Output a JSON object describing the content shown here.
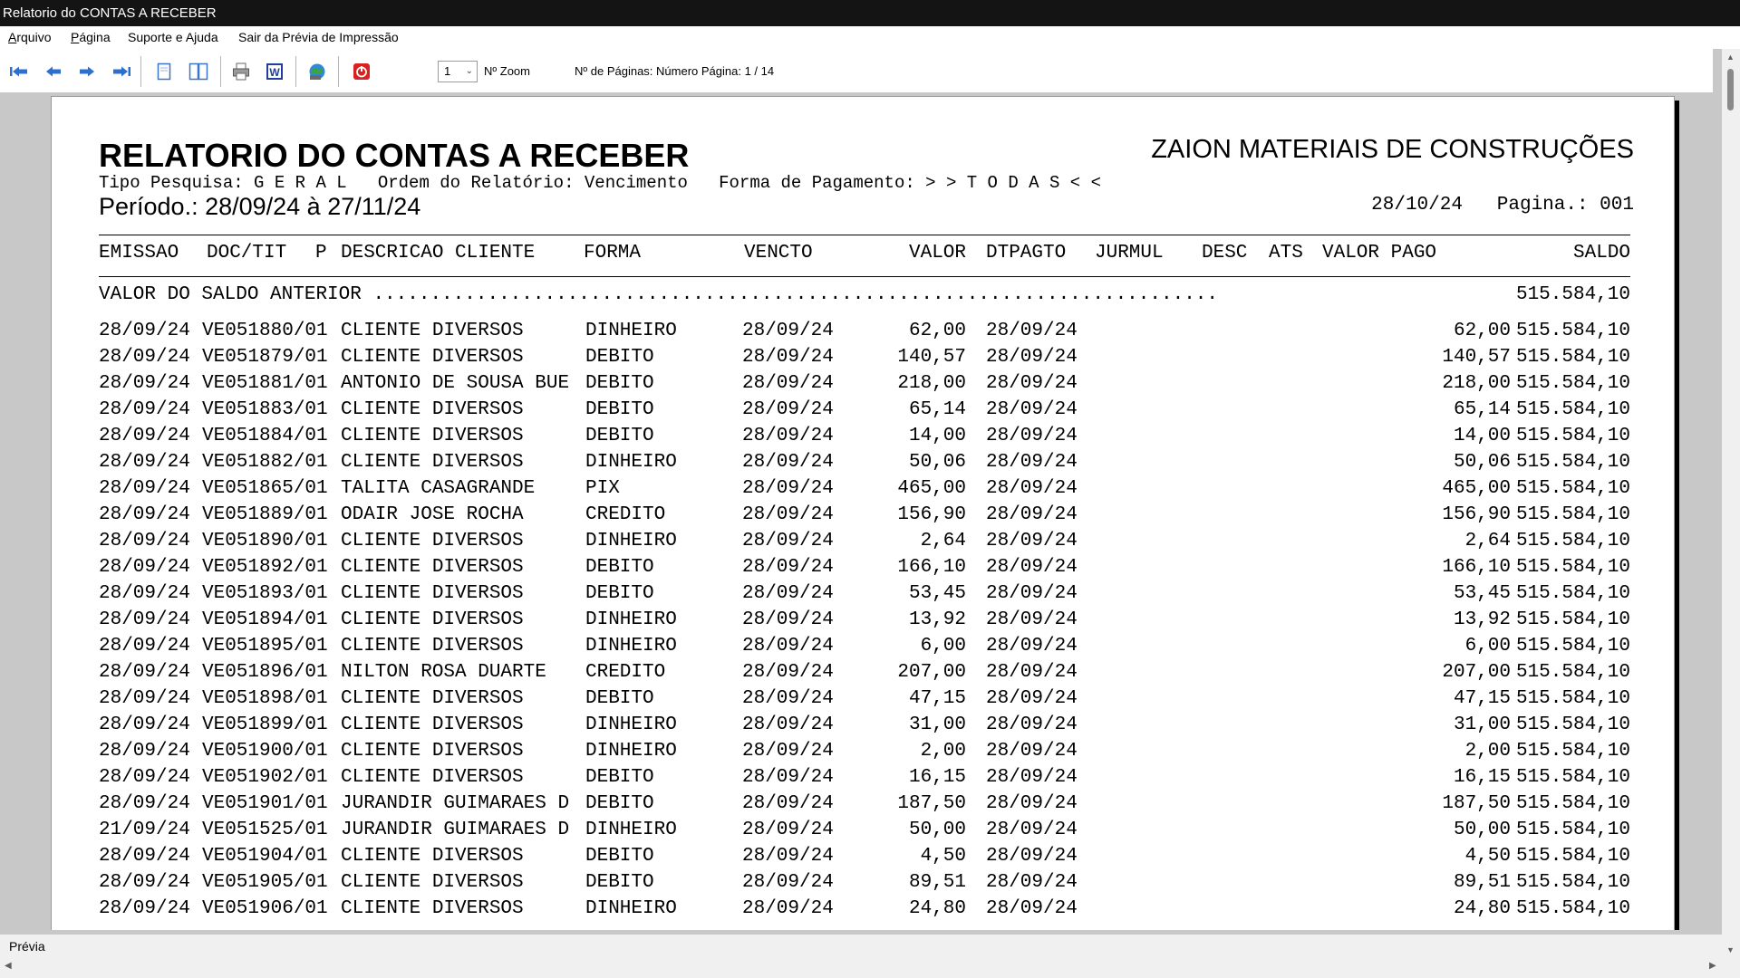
{
  "window": {
    "title": "Relatorio do CONTAS A RECEBER"
  },
  "menu": [
    "Arquivo",
    "Página",
    "Suporte e Ajuda",
    "Sair da Prévia de Impressão"
  ],
  "toolbar": {
    "icons": [
      "first-page-icon",
      "prev-page-icon",
      "next-page-icon",
      "last-page-icon",
      "single-page-icon",
      "two-page-icon",
      "print-icon",
      "word-export-icon",
      "web-export-icon",
      "close-preview-icon"
    ],
    "zoom_value": "1",
    "zoom_label": "Nº Zoom",
    "page_info": "Nº de Páginas: Número Página: 1 / 14"
  },
  "report": {
    "title": "RELATORIO DO CONTAS A RECEBER",
    "company": "ZAION MATERIAIS DE CONSTRUÇÕES",
    "filters": "Tipo Pesquisa: G E R A L   Ordem do Relatório: Vencimento   Forma de Pagamento: > > T O D A S < <",
    "period": "Período.: 28/09/24 à 27/11/24",
    "date_page": "28/10/24   Pagina.: 001",
    "columns": {
      "emissao": "EMISSAO",
      "doc": "DOC/TIT",
      "p": "P",
      "descricao": "DESCRICAO CLIENTE",
      "forma": "FORMA",
      "vencto": "VENCTO",
      "valor": "VALOR",
      "dtpagto": "DTPAGTO",
      "jurmul": "JURMUL",
      "desc": "DESC",
      "ats": "ATS",
      "valor_pago": "VALOR PAGO",
      "saldo": "SALDO"
    },
    "previous_balance": {
      "label": "VALOR DO SALDO ANTERIOR ..........................................................................",
      "value": "515.584,10"
    },
    "rows": [
      {
        "emissao": "28/09/24",
        "doc": "VE051880/01",
        "cliente": "CLIENTE DIVERSOS",
        "forma": "DINHEIRO",
        "vencto": "28/09/24",
        "valor": "62,00",
        "dtpagto": "28/09/24",
        "pago": "62,00",
        "saldo": "515.584,10"
      },
      {
        "emissao": "28/09/24",
        "doc": "VE051879/01",
        "cliente": "CLIENTE DIVERSOS",
        "forma": "DEBITO",
        "vencto": "28/09/24",
        "valor": "140,57",
        "dtpagto": "28/09/24",
        "pago": "140,57",
        "saldo": "515.584,10"
      },
      {
        "emissao": "28/09/24",
        "doc": "VE051881/01",
        "cliente": "ANTONIO DE SOUSA BUE",
        "forma": "DEBITO",
        "vencto": "28/09/24",
        "valor": "218,00",
        "dtpagto": "28/09/24",
        "pago": "218,00",
        "saldo": "515.584,10"
      },
      {
        "emissao": "28/09/24",
        "doc": "VE051883/01",
        "cliente": "CLIENTE DIVERSOS",
        "forma": "DEBITO",
        "vencto": "28/09/24",
        "valor": "65,14",
        "dtpagto": "28/09/24",
        "pago": "65,14",
        "saldo": "515.584,10"
      },
      {
        "emissao": "28/09/24",
        "doc": "VE051884/01",
        "cliente": "CLIENTE DIVERSOS",
        "forma": "DEBITO",
        "vencto": "28/09/24",
        "valor": "14,00",
        "dtpagto": "28/09/24",
        "pago": "14,00",
        "saldo": "515.584,10"
      },
      {
        "emissao": "28/09/24",
        "doc": "VE051882/01",
        "cliente": "CLIENTE DIVERSOS",
        "forma": "DINHEIRO",
        "vencto": "28/09/24",
        "valor": "50,06",
        "dtpagto": "28/09/24",
        "pago": "50,06",
        "saldo": "515.584,10"
      },
      {
        "emissao": "28/09/24",
        "doc": "VE051865/01",
        "cliente": "TALITA CASAGRANDE",
        "forma": "PIX",
        "vencto": "28/09/24",
        "valor": "465,00",
        "dtpagto": "28/09/24",
        "pago": "465,00",
        "saldo": "515.584,10"
      },
      {
        "emissao": "28/09/24",
        "doc": "VE051889/01",
        "cliente": "ODAIR JOSE ROCHA",
        "forma": "CREDITO",
        "vencto": "28/09/24",
        "valor": "156,90",
        "dtpagto": "28/09/24",
        "pago": "156,90",
        "saldo": "515.584,10"
      },
      {
        "emissao": "28/09/24",
        "doc": "VE051890/01",
        "cliente": "CLIENTE DIVERSOS",
        "forma": "DINHEIRO",
        "vencto": "28/09/24",
        "valor": "2,64",
        "dtpagto": "28/09/24",
        "pago": "2,64",
        "saldo": "515.584,10"
      },
      {
        "emissao": "28/09/24",
        "doc": "VE051892/01",
        "cliente": "CLIENTE DIVERSOS",
        "forma": "DEBITO",
        "vencto": "28/09/24",
        "valor": "166,10",
        "dtpagto": "28/09/24",
        "pago": "166,10",
        "saldo": "515.584,10"
      },
      {
        "emissao": "28/09/24",
        "doc": "VE051893/01",
        "cliente": "CLIENTE DIVERSOS",
        "forma": "DEBITO",
        "vencto": "28/09/24",
        "valor": "53,45",
        "dtpagto": "28/09/24",
        "pago": "53,45",
        "saldo": "515.584,10"
      },
      {
        "emissao": "28/09/24",
        "doc": "VE051894/01",
        "cliente": "CLIENTE DIVERSOS",
        "forma": "DINHEIRO",
        "vencto": "28/09/24",
        "valor": "13,92",
        "dtpagto": "28/09/24",
        "pago": "13,92",
        "saldo": "515.584,10"
      },
      {
        "emissao": "28/09/24",
        "doc": "VE051895/01",
        "cliente": "CLIENTE DIVERSOS",
        "forma": "DINHEIRO",
        "vencto": "28/09/24",
        "valor": "6,00",
        "dtpagto": "28/09/24",
        "pago": "6,00",
        "saldo": "515.584,10"
      },
      {
        "emissao": "28/09/24",
        "doc": "VE051896/01",
        "cliente": "NILTON ROSA DUARTE",
        "forma": "CREDITO",
        "vencto": "28/09/24",
        "valor": "207,00",
        "dtpagto": "28/09/24",
        "pago": "207,00",
        "saldo": "515.584,10"
      },
      {
        "emissao": "28/09/24",
        "doc": "VE051898/01",
        "cliente": "CLIENTE DIVERSOS",
        "forma": "DEBITO",
        "vencto": "28/09/24",
        "valor": "47,15",
        "dtpagto": "28/09/24",
        "pago": "47,15",
        "saldo": "515.584,10"
      },
      {
        "emissao": "28/09/24",
        "doc": "VE051899/01",
        "cliente": "CLIENTE DIVERSOS",
        "forma": "DINHEIRO",
        "vencto": "28/09/24",
        "valor": "31,00",
        "dtpagto": "28/09/24",
        "pago": "31,00",
        "saldo": "515.584,10"
      },
      {
        "emissao": "28/09/24",
        "doc": "VE051900/01",
        "cliente": "CLIENTE DIVERSOS",
        "forma": "DINHEIRO",
        "vencto": "28/09/24",
        "valor": "2,00",
        "dtpagto": "28/09/24",
        "pago": "2,00",
        "saldo": "515.584,10"
      },
      {
        "emissao": "28/09/24",
        "doc": "VE051902/01",
        "cliente": "CLIENTE DIVERSOS",
        "forma": "DEBITO",
        "vencto": "28/09/24",
        "valor": "16,15",
        "dtpagto": "28/09/24",
        "pago": "16,15",
        "saldo": "515.584,10"
      },
      {
        "emissao": "28/09/24",
        "doc": "VE051901/01",
        "cliente": "JURANDIR GUIMARAES D",
        "forma": "DEBITO",
        "vencto": "28/09/24",
        "valor": "187,50",
        "dtpagto": "28/09/24",
        "pago": "187,50",
        "saldo": "515.584,10"
      },
      {
        "emissao": "21/09/24",
        "doc": "VE051525/01",
        "cliente": "JURANDIR GUIMARAES D",
        "forma": "DINHEIRO",
        "vencto": "28/09/24",
        "valor": "50,00",
        "dtpagto": "28/09/24",
        "pago": "50,00",
        "saldo": "515.584,10"
      },
      {
        "emissao": "28/09/24",
        "doc": "VE051904/01",
        "cliente": "CLIENTE DIVERSOS",
        "forma": "DEBITO",
        "vencto": "28/09/24",
        "valor": "4,50",
        "dtpagto": "28/09/24",
        "pago": "4,50",
        "saldo": "515.584,10"
      },
      {
        "emissao": "28/09/24",
        "doc": "VE051905/01",
        "cliente": "CLIENTE DIVERSOS",
        "forma": "DEBITO",
        "vencto": "28/09/24",
        "valor": "89,51",
        "dtpagto": "28/09/24",
        "pago": "89,51",
        "saldo": "515.584,10"
      },
      {
        "emissao": "28/09/24",
        "doc": "VE051906/01",
        "cliente": "CLIENTE DIVERSOS",
        "forma": "DINHEIRO",
        "vencto": "28/09/24",
        "valor": "24,80",
        "dtpagto": "28/09/24",
        "pago": "24,80",
        "saldo": "515.584,10"
      }
    ]
  },
  "status": {
    "text": "Prévia"
  }
}
